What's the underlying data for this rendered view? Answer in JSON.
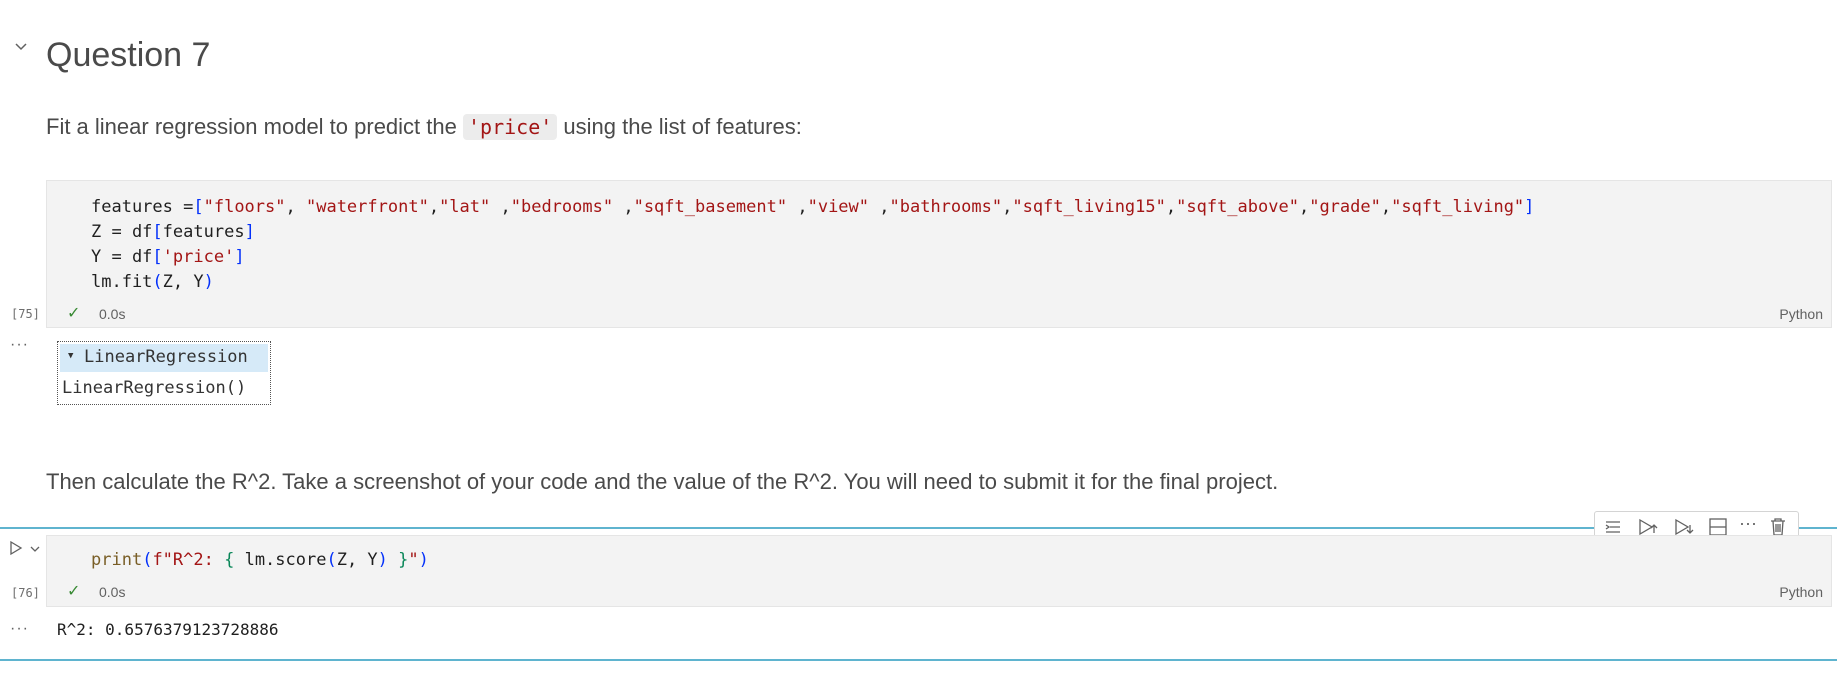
{
  "heading": {
    "title": "Question 7"
  },
  "intro": {
    "before": "Fit a linear regression model to predict the ",
    "code": "'price'",
    "after": " using the list of features:"
  },
  "cell1": {
    "exec_count": "[75]",
    "duration": "0.0s",
    "language": "Python"
  },
  "output1": {
    "widget_title": "LinearRegression",
    "widget_body": "LinearRegression()"
  },
  "instruction": {
    "text": "Then calculate the R^2. Take a screenshot of your code and the value of the R^2. You will need to submit it for the final project."
  },
  "cell2": {
    "exec_count": "[76]",
    "duration": "0.0s",
    "language": "Python",
    "output": "R^2: 0.6576379123728886"
  },
  "icons": {
    "collapse": "chevron-down-icon",
    "check": "check-icon",
    "run": "play-icon",
    "more": "ellipsis-icon"
  }
}
